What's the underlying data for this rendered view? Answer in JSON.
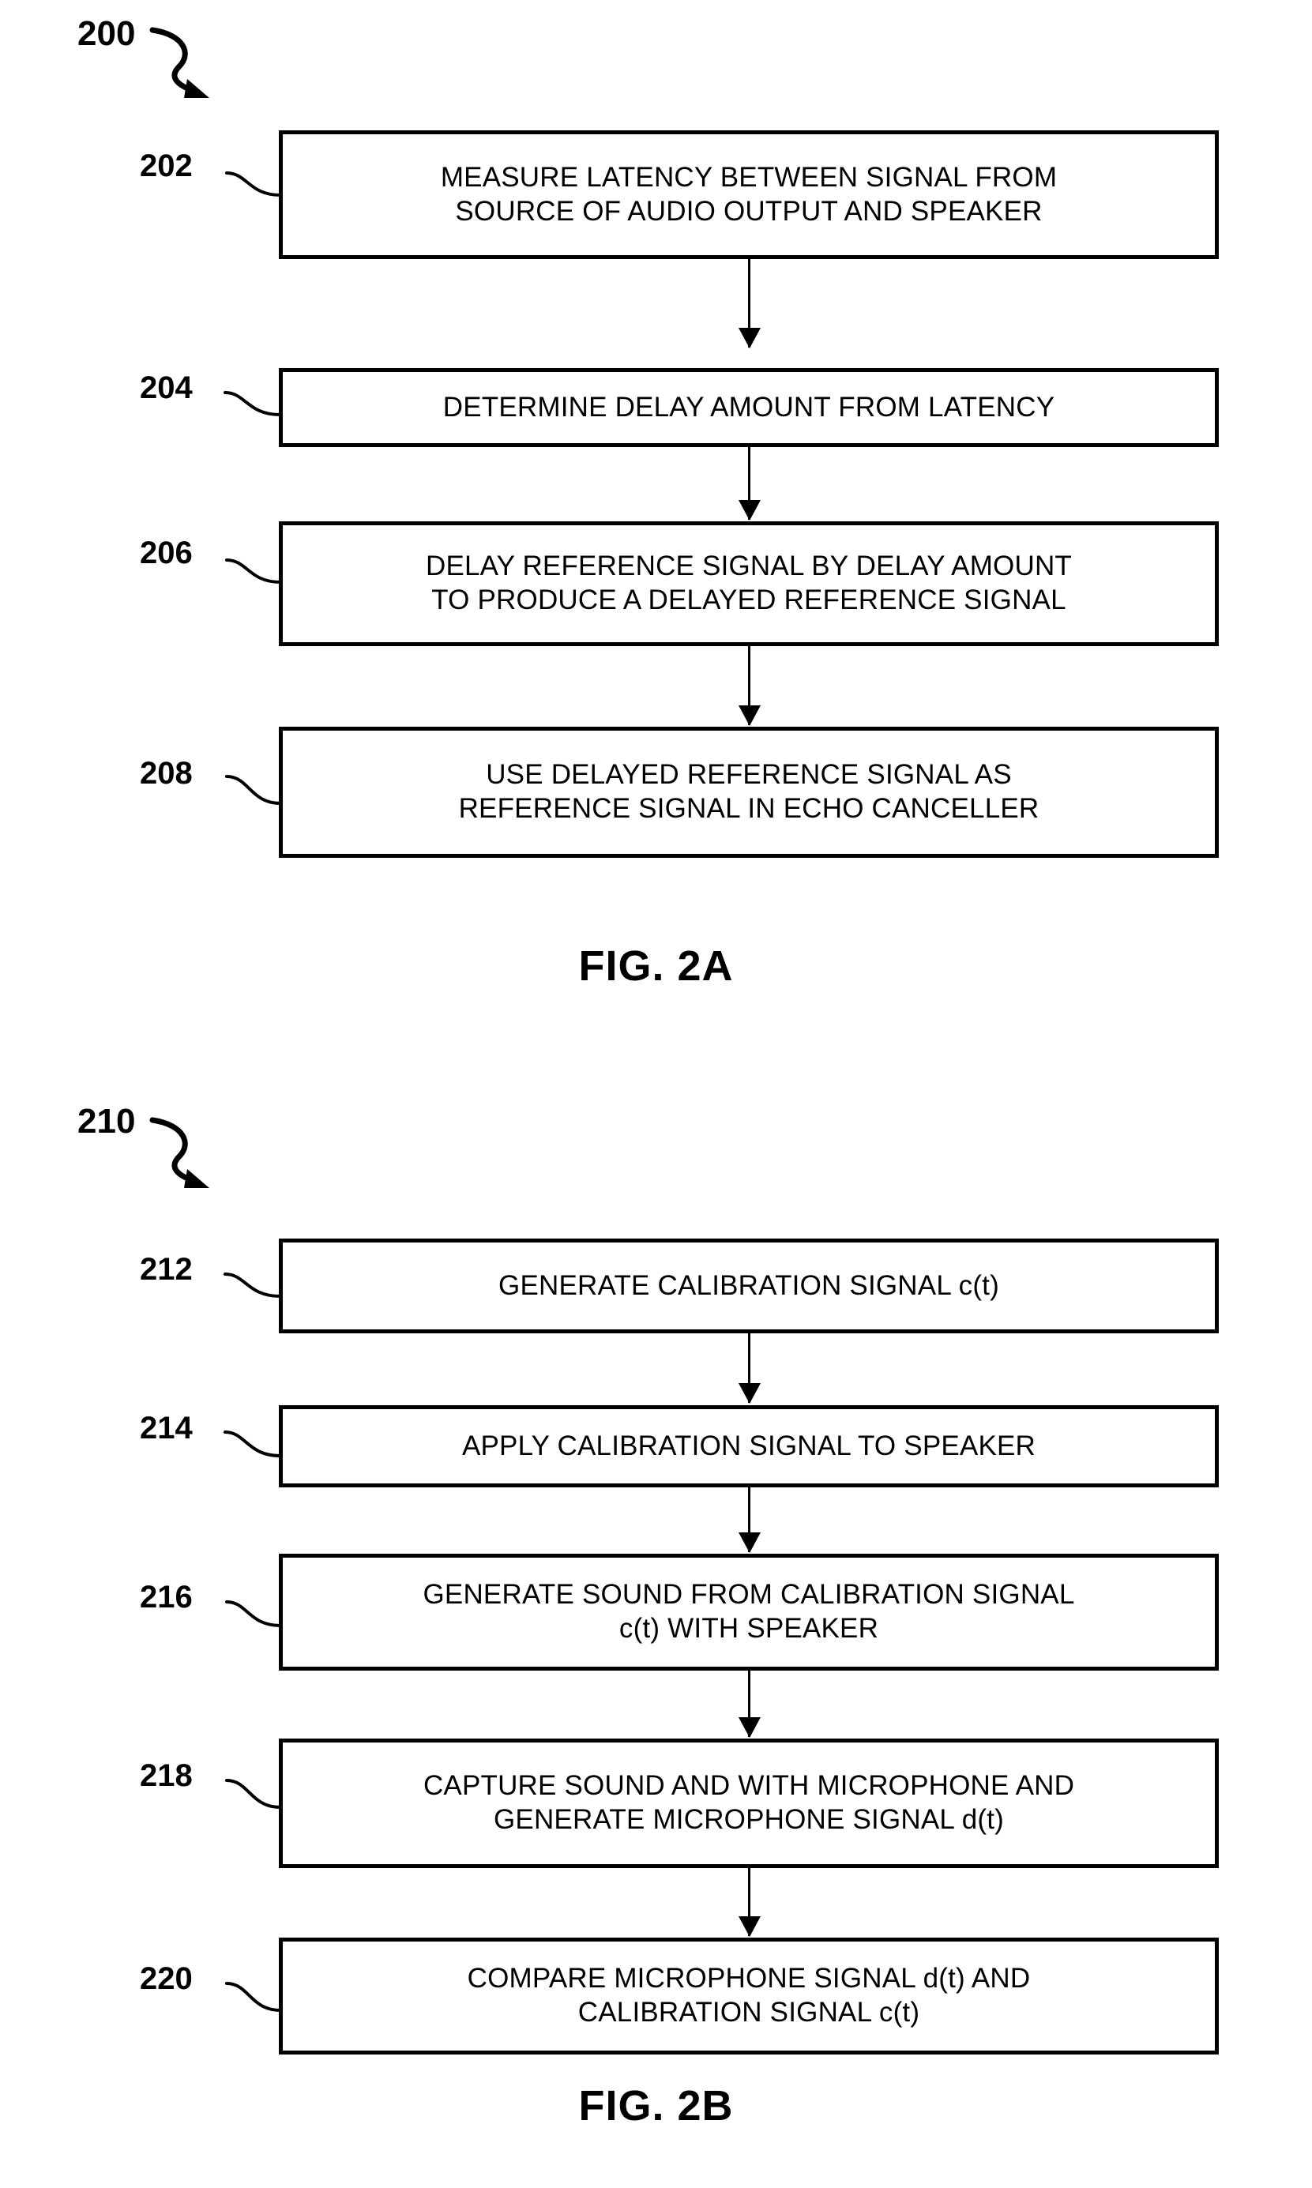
{
  "document": {
    "type": "patent-flowchart-sheet",
    "ink_color": "#000000",
    "background_color": "#ffffff"
  },
  "figures": [
    {
      "id": "fig-2a",
      "caption": "FIG. 2A",
      "flow_id": "200",
      "steps": [
        {
          "ref": "202",
          "text": "MEASURE LATENCY BETWEEN SIGNAL FROM\nSOURCE OF AUDIO OUTPUT AND SPEAKER"
        },
        {
          "ref": "204",
          "text": "DETERMINE DELAY AMOUNT FROM LATENCY"
        },
        {
          "ref": "206",
          "text": "DELAY REFERENCE SIGNAL BY DELAY AMOUNT\nTO PRODUCE A DELAYED REFERENCE SIGNAL"
        },
        {
          "ref": "208",
          "text": "USE DELAYED REFERENCE SIGNAL AS\nREFERENCE SIGNAL IN ECHO CANCELLER"
        }
      ]
    },
    {
      "id": "fig-2b",
      "caption": "FIG. 2B",
      "flow_id": "210",
      "steps": [
        {
          "ref": "212",
          "text": "GENERATE CALIBRATION SIGNAL c(t)"
        },
        {
          "ref": "214",
          "text": "APPLY CALIBRATION SIGNAL TO SPEAKER"
        },
        {
          "ref": "216",
          "text": "GENERATE SOUND FROM CALIBRATION SIGNAL\nc(t) WITH SPEAKER"
        },
        {
          "ref": "218",
          "text": "CAPTURE SOUND AND WITH MICROPHONE AND\nGENERATE MICROPHONE SIGNAL d(t)"
        },
        {
          "ref": "220",
          "text": "COMPARE MICROPHONE SIGNAL d(t) AND\nCALIBRATION SIGNAL c(t)"
        }
      ]
    }
  ]
}
